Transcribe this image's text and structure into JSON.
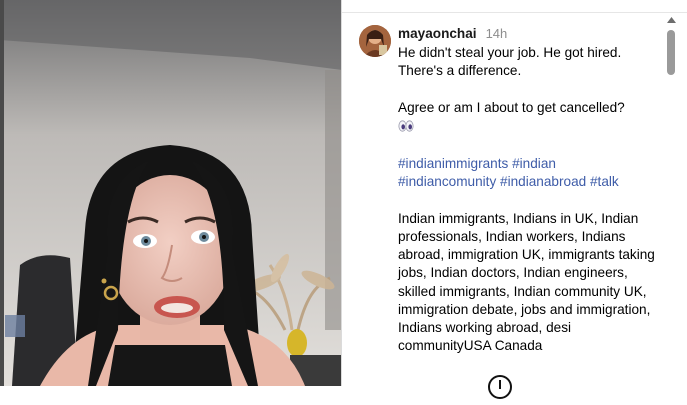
{
  "post": {
    "username": "mayaonchai",
    "timestamp": "14h",
    "caption_line1": "He didn't steal your job. He got hired. There's a difference.",
    "caption_line2": "Agree or am I about to get cancelled?",
    "emoji": "eyes-emoji",
    "hashtags": [
      "#indianimmigrants",
      "#indian",
      "#indiancomunity",
      "#indianabroad",
      "#talk"
    ],
    "keywords": "Indian immigrants, Indians in UK, Indian professionals, Indian workers, Indians abroad, immigration UK, immigrants taking jobs, Indian doctors, Indian engineers, skilled immigrants, Indian community UK, immigration debate, jobs and immigration, Indians working abroad, desi communityUSA Canada"
  },
  "icons": {
    "scroll_up": "triangle-up-icon",
    "bottom": "more-options-icon"
  },
  "colors": {
    "hashtag": "#3e5ca8",
    "timestamp": "#8e8e8e"
  }
}
